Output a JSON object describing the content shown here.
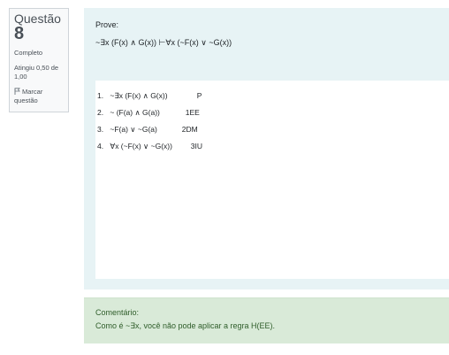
{
  "question_info": {
    "label": "Questão",
    "number": "8",
    "state": "Completo",
    "grade": "Atingiu 0,50 de 1,00",
    "flag_label": "Marcar questão",
    "flag_icon": "flag-icon"
  },
  "prompt": {
    "title": "Prove:",
    "formula": "~∃x (F(x) ∧ G(x)) ⊢∀x (~F(x) ∨ ~G(x))"
  },
  "answer": {
    "lines": [
      {
        "num": "1.",
        "step": "~∃x (F(x) ∧ G(x))",
        "rule": "P"
      },
      {
        "num": "2.",
        "step": "~ (F(a) ∧ G(a))",
        "rule": "1EE"
      },
      {
        "num": "3.",
        "step": "~F(a) ∨ ~G(a)",
        "rule": "2DM"
      },
      {
        "num": "4.",
        "step": "∀x (~F(x) ∨ ~G(x))",
        "rule": "3IU"
      }
    ]
  },
  "feedback": {
    "title": "Comentário:",
    "text": "Como é ~∃x, você não pode aplicar a regra H(EE)."
  },
  "colors": {
    "formulation_bg": "#e7f3f5",
    "feedback_bg": "#d9ead8",
    "feedback_text": "#2f5d2a",
    "info_bg": "#f8f9fa"
  }
}
